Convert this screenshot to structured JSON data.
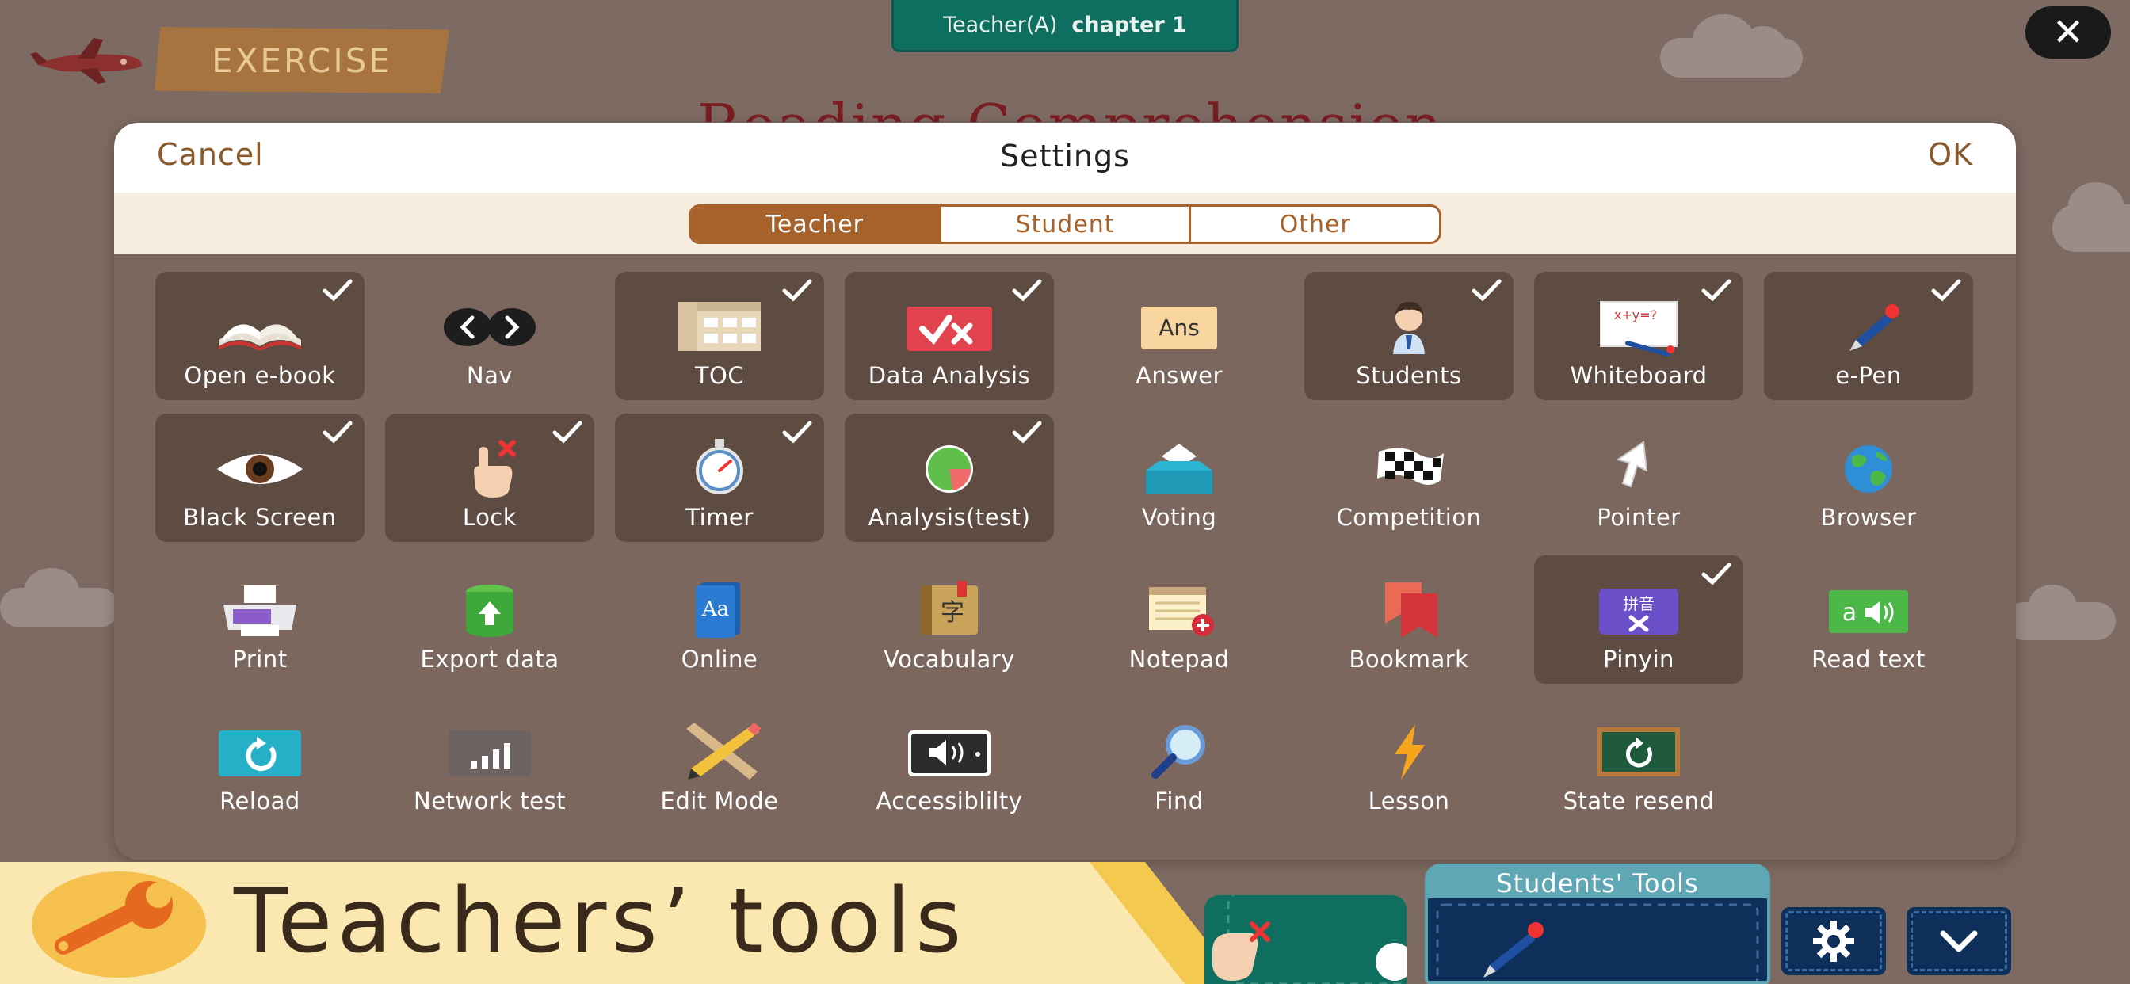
{
  "header": {
    "role": "Teacher(A)",
    "course": "chapter 1",
    "exercise_label": "EXERCISE",
    "background_title": "Reading Comprehension"
  },
  "settings": {
    "title": "Settings",
    "cancel_label": "Cancel",
    "ok_label": "OK",
    "tabs": [
      {
        "label": "Teacher",
        "active": true
      },
      {
        "label": "Student",
        "active": false
      },
      {
        "label": "Other",
        "active": false
      }
    ],
    "tools": [
      {
        "label": "Open e-book",
        "icon": "book-icon",
        "enabled": true
      },
      {
        "label": "Nav",
        "icon": "nav-arrows-icon",
        "enabled": false
      },
      {
        "label": "TOC",
        "icon": "toc-icon",
        "enabled": true
      },
      {
        "label": "Data Analysis",
        "icon": "data-analysis-icon",
        "enabled": true
      },
      {
        "label": "Answer",
        "icon": "answer-icon",
        "enabled": false
      },
      {
        "label": "Students",
        "icon": "student-icon",
        "enabled": true
      },
      {
        "label": "Whiteboard",
        "icon": "whiteboard-icon",
        "enabled": true
      },
      {
        "label": "e-Pen",
        "icon": "pen-icon",
        "enabled": true
      },
      {
        "label": "Black Screen",
        "icon": "eye-icon",
        "enabled": true
      },
      {
        "label": "Lock",
        "icon": "lock-hand-icon",
        "enabled": true
      },
      {
        "label": "Timer",
        "icon": "stopwatch-icon",
        "enabled": true
      },
      {
        "label": "Analysis(test)",
        "icon": "pie-chart-icon",
        "enabled": true
      },
      {
        "label": "Voting",
        "icon": "ballot-box-icon",
        "enabled": false
      },
      {
        "label": "Competition",
        "icon": "checkered-flag-icon",
        "enabled": false
      },
      {
        "label": "Pointer",
        "icon": "pointer-arrow-icon",
        "enabled": false
      },
      {
        "label": "Browser",
        "icon": "globe-icon",
        "enabled": false
      },
      {
        "label": "Print",
        "icon": "printer-icon",
        "enabled": false
      },
      {
        "label": "Export data",
        "icon": "database-export-icon",
        "enabled": false
      },
      {
        "label": "Online",
        "icon": "dictionary-icon",
        "enabled": false
      },
      {
        "label": "Vocabulary",
        "icon": "vocabulary-book-icon",
        "enabled": false
      },
      {
        "label": "Notepad",
        "icon": "notepad-icon",
        "enabled": false
      },
      {
        "label": "Bookmark",
        "icon": "bookmark-icon",
        "enabled": false
      },
      {
        "label": "Pinyin",
        "icon": "pinyin-icon",
        "enabled": true
      },
      {
        "label": "Read text",
        "icon": "read-text-icon",
        "enabled": false
      },
      {
        "label": "Reload",
        "icon": "reload-icon",
        "enabled": false
      },
      {
        "label": "Network test",
        "icon": "signal-bars-icon",
        "enabled": false
      },
      {
        "label": "Edit Mode",
        "icon": "ruler-pencil-icon",
        "enabled": false
      },
      {
        "label": "Accessiblilty",
        "icon": "speaker-icon",
        "enabled": false
      },
      {
        "label": "Find",
        "icon": "magnifier-icon",
        "enabled": false
      },
      {
        "label": "Lesson",
        "icon": "lightning-icon",
        "enabled": false
      },
      {
        "label": "State resend",
        "icon": "board-reload-icon",
        "enabled": false
      }
    ],
    "icon_glyphs": {
      "answer": "Ans",
      "whiteboard": "x+y=?",
      "pinyin": "拼音",
      "vocabulary": "字",
      "dictionary": "Aa",
      "read_text": "a"
    }
  },
  "footer": {
    "banner_title": "Teachers’ tools",
    "students_tools_label": "Students' Tools"
  },
  "colors": {
    "background": "#7d6a62",
    "panel": "#7b675d",
    "tile_enabled": "#5e4b42",
    "accent_brown": "#a6622a",
    "header_green": "#0e6e5f",
    "dock_navy": "#0e2f5a",
    "banner_yellow": "#fbe7b0"
  }
}
